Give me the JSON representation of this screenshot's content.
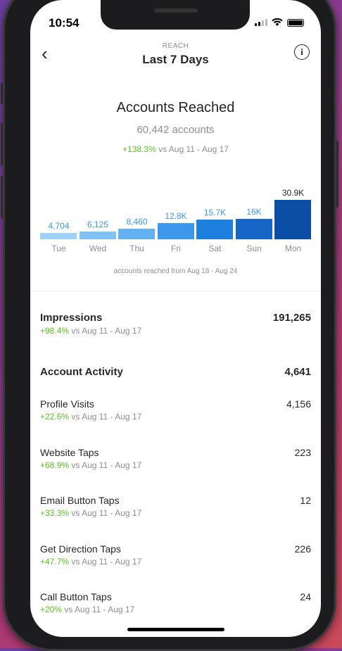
{
  "status": {
    "time": "10:54"
  },
  "header": {
    "subtitle": "REACH",
    "title": "Last 7 Days"
  },
  "summary": {
    "title": "Accounts Reached",
    "count": "60,442 accounts",
    "change": "+138.3%",
    "change_suffix": "vs Aug 11 - Aug 17"
  },
  "chart_data": {
    "type": "bar",
    "categories": [
      "Tue",
      "Wed",
      "Thu",
      "Fri",
      "Sat",
      "Sun",
      "Mon"
    ],
    "values": [
      4704,
      6125,
      8460,
      12800,
      15700,
      16000,
      30900
    ],
    "value_labels": [
      "4,704",
      "6,125",
      "8,460",
      "12.8K",
      "15.7K",
      "16K",
      "30.9K"
    ],
    "colors": [
      "#9ed2f8",
      "#80c2f5",
      "#63b1f1",
      "#3d97eb",
      "#1f7fde",
      "#1566c7",
      "#0b4ea5"
    ],
    "note": "accounts reached from Aug 18 - Aug 24"
  },
  "impressions": {
    "label": "Impressions",
    "value": "191,265",
    "change": "+98.4%",
    "suffix": "vs Aug 11 - Aug 17"
  },
  "activity": {
    "label": "Account Activity",
    "value": "4,641",
    "items": [
      {
        "label": "Profile Visits",
        "value": "4,156",
        "change": "+22.6%",
        "suffix": "vs Aug 11 - Aug 17"
      },
      {
        "label": "Website Taps",
        "value": "223",
        "change": "+68.9%",
        "suffix": "vs Aug 11 - Aug 17"
      },
      {
        "label": "Email Button Taps",
        "value": "12",
        "change": "+33.3%",
        "suffix": "vs Aug 11 - Aug 17"
      },
      {
        "label": "Get Direction Taps",
        "value": "226",
        "change": "+47.7%",
        "suffix": "vs Aug 11 - Aug 17"
      },
      {
        "label": "Call Button Taps",
        "value": "24",
        "change": "+20%",
        "suffix": "vs Aug 11 - Aug 17"
      }
    ]
  }
}
